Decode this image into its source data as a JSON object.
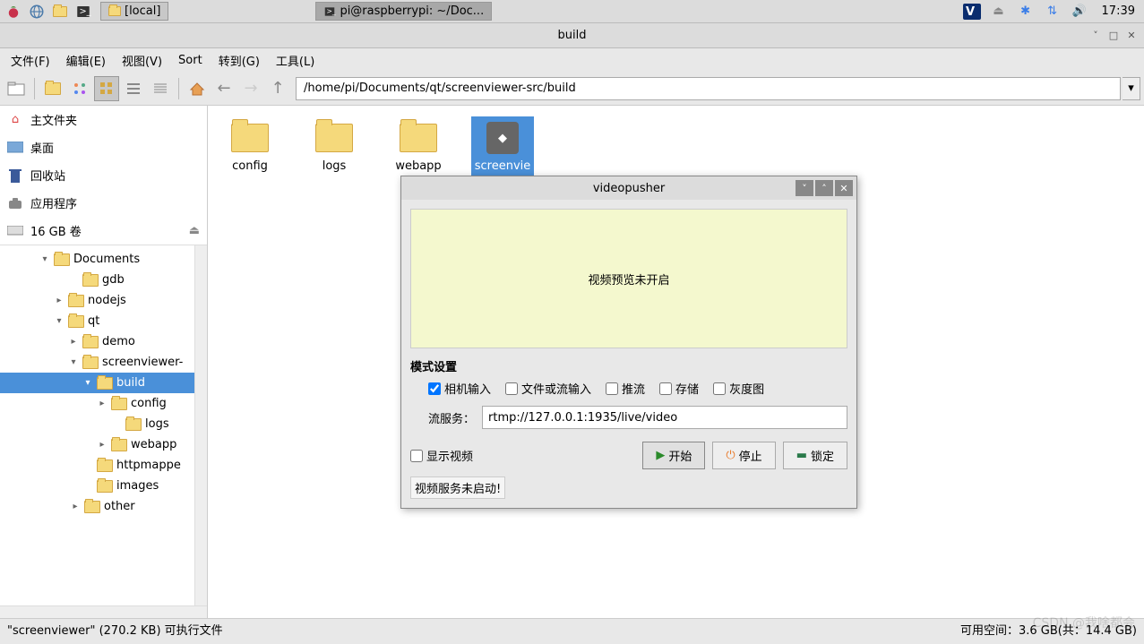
{
  "taskbar": {
    "local_label": "[local]",
    "terminal_label": "pi@raspberrypi: ~/Doc...",
    "time": "17:39"
  },
  "window": {
    "title": "build"
  },
  "menu": {
    "file": "文件(F)",
    "edit": "编辑(E)",
    "view": "视图(V)",
    "sort": "Sort",
    "goto": "转到(G)",
    "tools": "工具(L)"
  },
  "path": "/home/pi/Documents/qt/screenviewer-src/build",
  "places": {
    "home": "主文件夹",
    "desktop": "桌面",
    "trash": "回收站",
    "apps": "应用程序",
    "volume": "16 GB 卷"
  },
  "tree": {
    "documents": "Documents",
    "gdb": "gdb",
    "nodejs": "nodejs",
    "qt": "qt",
    "demo": "demo",
    "screenviewer": "screenviewer-",
    "build": "build",
    "config": "config",
    "logs": "logs",
    "webapp": "webapp",
    "httpmappe": "httpmappe",
    "images": "images",
    "other": "other"
  },
  "files": {
    "config": "config",
    "logs": "logs",
    "webapp": "webapp",
    "screenvie": "screenvie"
  },
  "status": {
    "left": "\"screenviewer\" (270.2 KB) 可执行文件",
    "right": "可用空间：3.6 GB(共：14.4 GB)"
  },
  "dialog": {
    "title": "videopusher",
    "preview": "视频预览未开启",
    "mode_label": "模式设置",
    "camera": "相机输入",
    "file_stream": "文件或流输入",
    "push": "推流",
    "save": "存储",
    "gray": "灰度图",
    "stream_label": "流服务：",
    "stream_value": "rtmp://127.0.0.1:1935/live/video",
    "show_video": "显示视频",
    "start": "开始",
    "stop": "停止",
    "lock": "锁定",
    "status": "视频服务未启动!"
  },
  "watermark": "CSDN @我啥都会"
}
